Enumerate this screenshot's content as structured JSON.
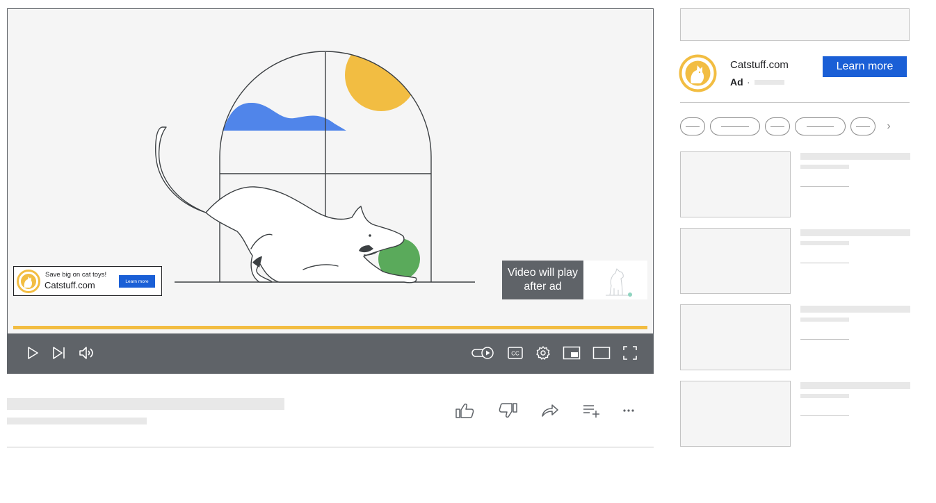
{
  "player": {
    "overlay_ad": {
      "tagline": "Save big on cat toys!",
      "advertiser": "Catstuff.com",
      "cta": "Learn more"
    },
    "countdown_text": "Video will play after ad",
    "controls": {
      "left": [
        "play-icon",
        "skip-next-icon",
        "volume-icon"
      ],
      "right": [
        "autoplay-toggle-icon",
        "closed-captions-icon",
        "settings-gear-icon",
        "miniplayer-icon",
        "theater-mode-icon",
        "fullscreen-icon"
      ],
      "cc_label": "CC"
    }
  },
  "actions": [
    "like-icon",
    "dislike-icon",
    "share-icon",
    "save-to-playlist-icon",
    "more-icon"
  ],
  "sidebar": {
    "ad": {
      "advertiser": "Catstuff.com",
      "label": "Ad",
      "separator": "·",
      "cta": "Learn more"
    },
    "chips_next": "›"
  },
  "colors": {
    "brand_blue": "#1a5fd6",
    "ad_yellow": "#f2bd42",
    "control_bar": "#5f6368",
    "ball_green": "#5aaa5b",
    "cloud_blue": "#5085ea"
  }
}
